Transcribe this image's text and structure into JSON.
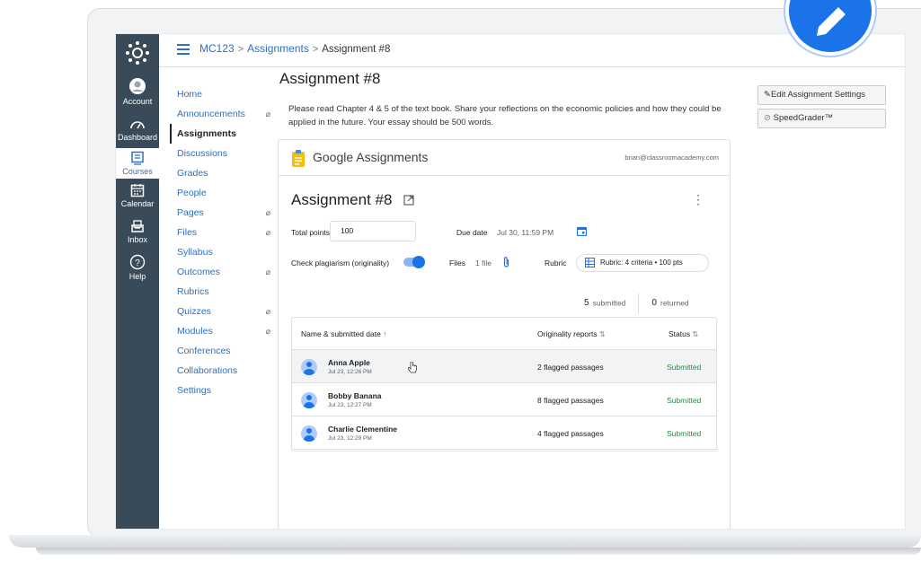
{
  "breadcrumb": {
    "course": "MC123",
    "section": "Assignments",
    "current": "Assignment #8",
    "separator": ">"
  },
  "global_nav": [
    {
      "label": "Account",
      "icon": "account-icon"
    },
    {
      "label": "Dashboard",
      "icon": "dashboard-icon"
    },
    {
      "label": "Courses",
      "icon": "courses-icon",
      "active": true
    },
    {
      "label": "Calendar",
      "icon": "calendar-icon"
    },
    {
      "label": "Inbox",
      "icon": "inbox-icon"
    },
    {
      "label": "Help",
      "icon": "help-icon"
    }
  ],
  "course_nav": [
    {
      "label": "Home"
    },
    {
      "label": "Announcements",
      "hidden": true
    },
    {
      "label": "Assignments",
      "active": true
    },
    {
      "label": "Discussions"
    },
    {
      "label": "Grades"
    },
    {
      "label": "People"
    },
    {
      "label": "Pages",
      "hidden": true
    },
    {
      "label": "Files",
      "hidden": true
    },
    {
      "label": "Syllabus"
    },
    {
      "label": "Outcomes",
      "hidden": true
    },
    {
      "label": "Rubrics"
    },
    {
      "label": "Quizzes",
      "hidden": true
    },
    {
      "label": "Modules",
      "hidden": true
    },
    {
      "label": "Conferences"
    },
    {
      "label": "Collaborations"
    },
    {
      "label": "Settings"
    }
  ],
  "hidden_glyph": "⌀",
  "assignment": {
    "title": "Assignment #8",
    "description": "Please read Chapter 4 & 5 of the text book. Share your reflections on the economic policies and how they could be applied in the future. Your essay should be 500 words."
  },
  "side_buttons": {
    "edit": "Edit Assignment Settings",
    "speedgrader": "SpeedGrader™"
  },
  "google": {
    "brand": "Google Assignments",
    "email": "brian@classroomacademy.com",
    "title": "Assignment #8",
    "total_points_label": "Total points",
    "total_points_value": "100",
    "due_label": "Due date",
    "due_value": "Jul 30, 11:59 PM",
    "plagiarism_label": "Check plagiarism (originality)",
    "plagiarism_on": true,
    "files_label": "Files",
    "files_value": "1 file",
    "rubric_label": "Rubric",
    "rubric_value": "Rubric: 4 criteria • 100 pts",
    "submitted_count": "5",
    "submitted_label": "submitted",
    "returned_count": "0",
    "returned_label": "returned",
    "table": {
      "col_name": "Name & submitted date",
      "col_reports": "Originality reports",
      "col_status": "Status",
      "rows": [
        {
          "name": "Anna Apple",
          "date": "Jul 23, 12:26 PM",
          "reports": "2 flagged passages",
          "status": "Submitted"
        },
        {
          "name": "Bobby Banana",
          "date": "Jul 23, 12:27 PM",
          "reports": "8 flagged passages",
          "status": "Submitted"
        },
        {
          "name": "Charlie Clementine",
          "date": "Jul 23, 12:29 PM",
          "reports": "4 flagged passages",
          "status": "Submitted"
        }
      ]
    }
  },
  "colors": {
    "canvas_nav": "#394b58",
    "link": "#2d6fbf",
    "google_blue": "#1a73e8",
    "submitted_green": "#1e8e3e"
  }
}
